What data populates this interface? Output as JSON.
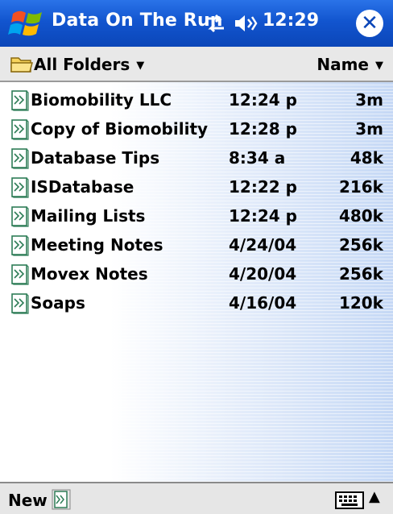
{
  "titlebar": {
    "app_title": "Data On The Run",
    "clock": "12:29",
    "close_glyph": "✕",
    "icons": [
      "windows-start-icon",
      "connectivity-icon",
      "speaker-icon",
      "close-icon"
    ]
  },
  "folderbar": {
    "folder_label": "All Folders",
    "sort_label": "Name",
    "icons": [
      "folder-icon",
      "caret-down-icon"
    ]
  },
  "files": [
    {
      "name": "Biomobility LLC",
      "date": "12:24 p",
      "size": "3m"
    },
    {
      "name": "Copy of Biomobility",
      "date": "12:28 p",
      "size": "3m"
    },
    {
      "name": "Database Tips",
      "date": "8:34 a",
      "size": "48k"
    },
    {
      "name": "ISDatabase",
      "date": "12:22 p",
      "size": "216k"
    },
    {
      "name": "Mailing Lists",
      "date": "12:24 p",
      "size": "480k"
    },
    {
      "name": "Meeting Notes",
      "date": "4/24/04",
      "size": "256k"
    },
    {
      "name": "Movex Notes",
      "date": "4/20/04",
      "size": "256k"
    },
    {
      "name": "Soaps",
      "date": "4/16/04",
      "size": "120k"
    }
  ],
  "bottombar": {
    "new_label": "New",
    "icons": [
      "database-document-icon",
      "keyboard-icon",
      "sip-up-arrow-icon"
    ]
  },
  "colors": {
    "titlebar": "#1255cf",
    "folderbar": "#e8e8e8",
    "list_gradient_end": "#c5d8f5"
  }
}
